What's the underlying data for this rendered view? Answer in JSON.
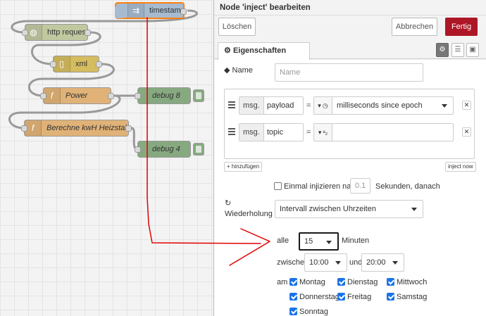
{
  "canvas": {
    "nodes": {
      "timestamp": "timestamp",
      "http": "http request",
      "xml": "xml",
      "power": "Power",
      "debug8": "debug 8",
      "berechne": "Berechne kwH Heizstab",
      "debug4": "debug 4"
    }
  },
  "tray": {
    "title": "Node 'inject' bearbeiten",
    "delete_label": "Löschen",
    "cancel_label": "Abbrechen",
    "done_label": "Fertig",
    "tab_properties": "Eigenschaften",
    "name_label": "Name",
    "name_placeholder": "Name",
    "props": [
      {
        "prefix": "msg.",
        "key": "payload",
        "type_value": "milliseconds since epoch"
      },
      {
        "prefix": "msg.",
        "key": "topic",
        "type_value": ""
      }
    ],
    "add_label": "+ hinzufügen",
    "inject_now_label": "inject now",
    "once_label": "Einmal injizieren nach",
    "once_value": "0.1",
    "once_suffix": "Sekunden, danach",
    "repeat_label": "Wiederholung",
    "repeat_value": "Intervall zwischen Uhrzeiten",
    "every_label": "alle",
    "every_value": "15",
    "every_unit": "Minuten",
    "between_label": "zwischen",
    "from_time": "10:00",
    "and_label": "und",
    "to_time": "20:00",
    "on_label": "am",
    "days": {
      "mon": "Montag",
      "tue": "Dienstag",
      "wed": "Mittwoch",
      "thu": "Donnerstag",
      "fri": "Freitag",
      "sat": "Samstag",
      "sun": "Sonntag"
    }
  },
  "colors": {
    "done_button": "#ad1625",
    "annotation_arrow": "#e00000",
    "selected_node_border": "#ff7f0e"
  }
}
